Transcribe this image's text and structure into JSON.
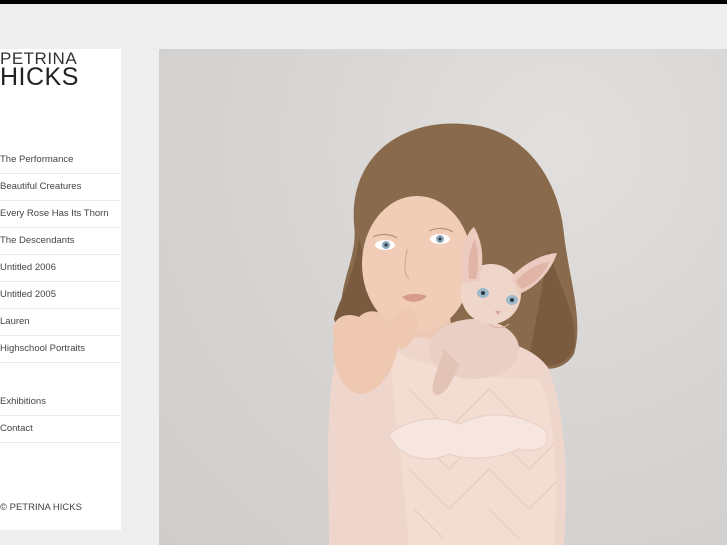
{
  "logo": {
    "first_name": "PETRINA",
    "last_name": "HICKS"
  },
  "nav": {
    "items": [
      {
        "label": "The Performance"
      },
      {
        "label": "Beautiful Creatures"
      },
      {
        "label": "Every Rose Has Its Thorn"
      },
      {
        "label": "The Descendants"
      },
      {
        "label": "Untitled 2006"
      },
      {
        "label": "Untitled 2005"
      },
      {
        "label": "Lauren"
      },
      {
        "label": "Highschool Portraits"
      }
    ],
    "secondary": [
      {
        "label": "Exhibitions"
      },
      {
        "label": "Contact"
      }
    ]
  },
  "footer": {
    "copyright": "© PETRINA HICKS"
  },
  "colors": {
    "top_bar": "#000000",
    "page_background": "#efefef",
    "sidebar_background": "#ffffff",
    "text": "#444444"
  }
}
